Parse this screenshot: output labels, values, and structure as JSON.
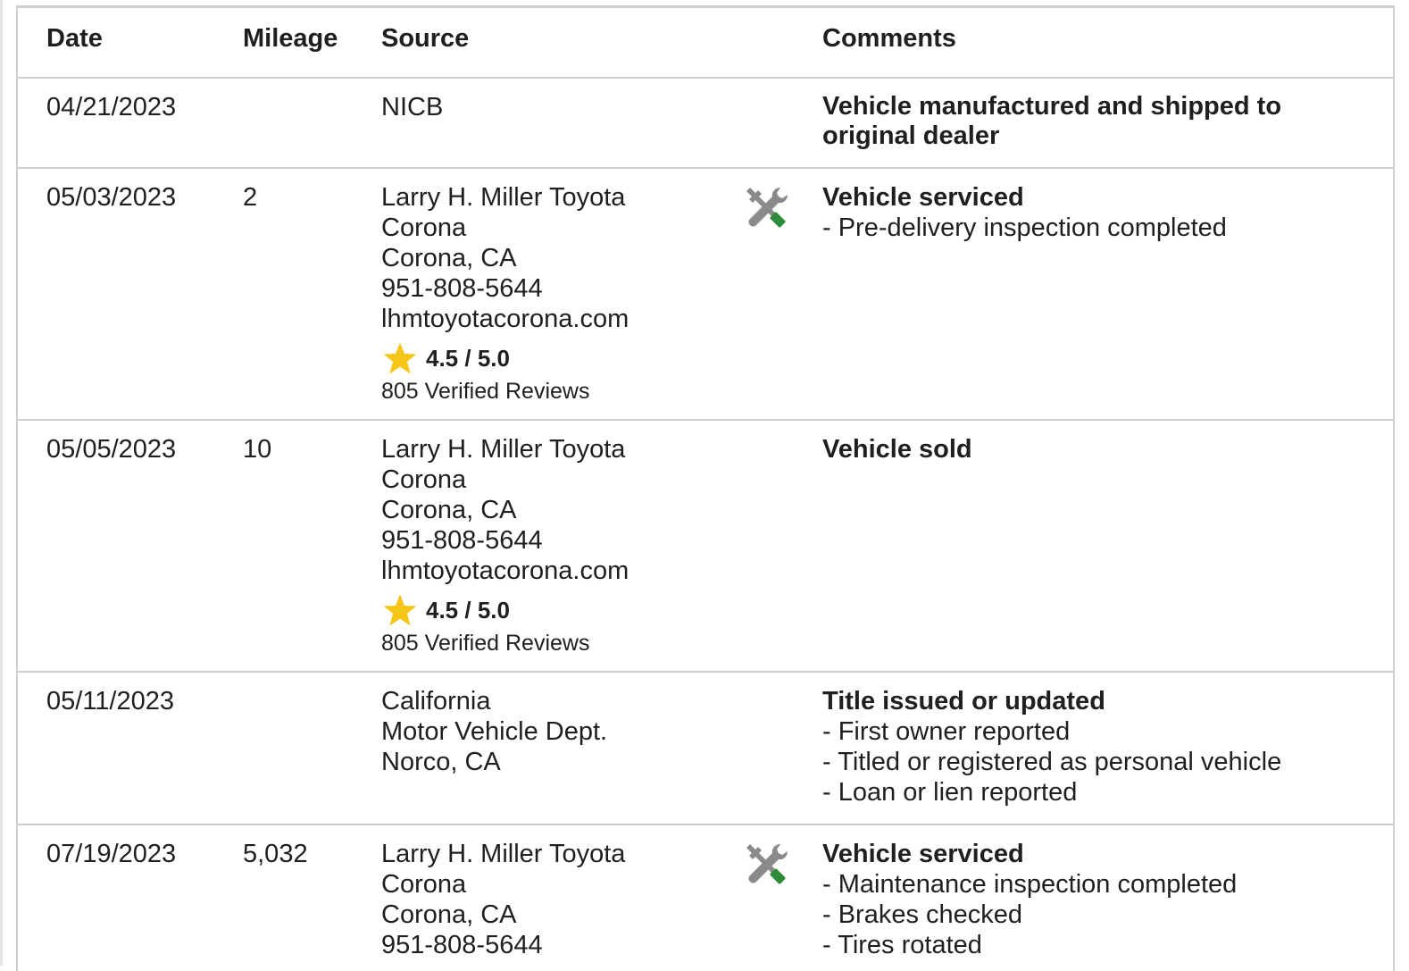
{
  "headers": {
    "date": "Date",
    "mileage": "Mileage",
    "source": "Source",
    "comments": "Comments"
  },
  "colors": {
    "border": "#cfcfcf",
    "star": "#f5c518",
    "wrench_handle": "#2e8b3a",
    "tool_gray": "#8a8a8a"
  },
  "rows": [
    {
      "date": "04/21/2023",
      "mileage": "",
      "source": [
        "NICB"
      ],
      "icon": "",
      "comment_title": "Vehicle manufactured and shipped to original dealer",
      "details": []
    },
    {
      "date": "05/03/2023",
      "mileage": "2",
      "source": [
        "Larry H. Miller Toyota",
        "Corona",
        "Corona, CA",
        "951-808-5644",
        "lhmtoyotacorona.com"
      ],
      "rating": "4.5 / 5.0",
      "reviews": "805 Verified Reviews",
      "icon": "wrench-screwdriver-icon",
      "comment_title": "Vehicle serviced",
      "details": [
        "- Pre-delivery inspection completed"
      ]
    },
    {
      "date": "05/05/2023",
      "mileage": "10",
      "source": [
        "Larry H. Miller Toyota",
        "Corona",
        "Corona, CA",
        "951-808-5644",
        "lhmtoyotacorona.com"
      ],
      "rating": "4.5 / 5.0",
      "reviews": "805 Verified Reviews",
      "icon": "",
      "comment_title": "Vehicle sold",
      "details": []
    },
    {
      "date": "05/11/2023",
      "mileage": "",
      "source": [
        "California",
        "Motor Vehicle Dept.",
        "Norco, CA"
      ],
      "icon": "",
      "comment_title": "Title issued or updated",
      "details": [
        "- First owner reported",
        "- Titled or registered as personal vehicle",
        "- Loan or lien reported"
      ]
    },
    {
      "date": "07/19/2023",
      "mileage": "5,032",
      "source": [
        "Larry H. Miller Toyota",
        "Corona",
        "Corona, CA",
        "951-808-5644"
      ],
      "icon": "wrench-screwdriver-icon",
      "comment_title": "Vehicle serviced",
      "details": [
        "- Maintenance inspection completed",
        "- Brakes checked",
        "- Tires rotated"
      ]
    }
  ]
}
